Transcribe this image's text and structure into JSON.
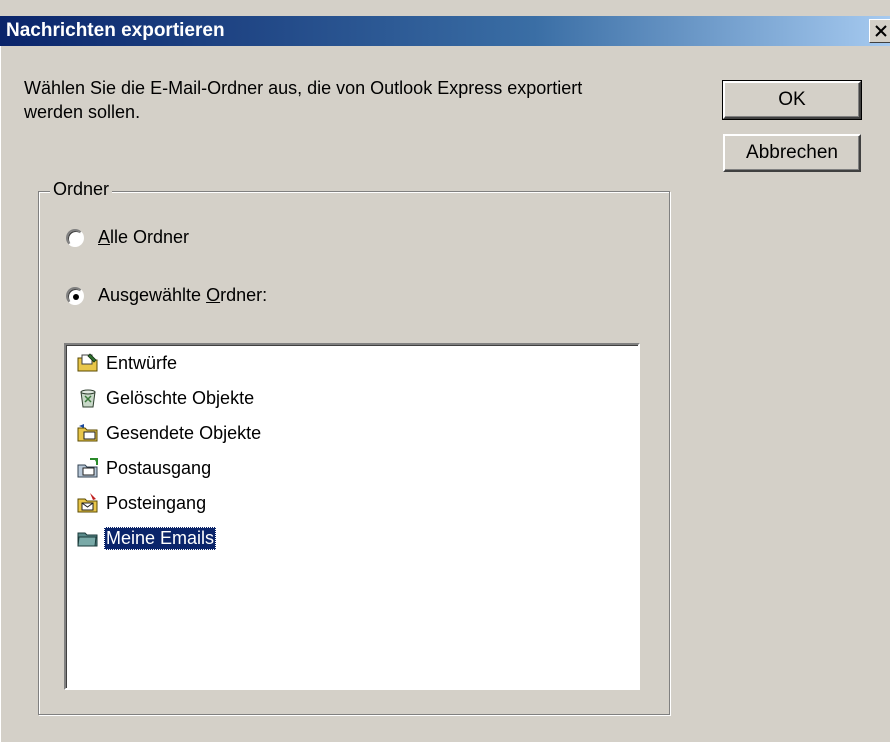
{
  "window": {
    "title": "Nachrichten exportieren"
  },
  "instruction": "Wählen Sie die E-Mail-Ordner aus, die von Outlook Express exportiert werden sollen.",
  "buttons": {
    "ok": "OK",
    "cancel": "Abbrechen"
  },
  "group": {
    "label": "Ordner",
    "radio_all": {
      "prefix": "",
      "mnemonic": "A",
      "suffix": "lle Ordner",
      "checked": false
    },
    "radio_selected": {
      "prefix": "Ausgewählte ",
      "mnemonic": "O",
      "suffix": "rdner:",
      "checked": true
    }
  },
  "folders": [
    {
      "label": "Entwürfe",
      "icon": "drafts-folder-icon",
      "selected": false
    },
    {
      "label": "Gelöschte Objekte",
      "icon": "deleted-items-folder-icon",
      "selected": false
    },
    {
      "label": "Gesendete Objekte",
      "icon": "sent-items-folder-icon",
      "selected": false
    },
    {
      "label": "Postausgang",
      "icon": "outbox-folder-icon",
      "selected": false
    },
    {
      "label": "Posteingang",
      "icon": "inbox-folder-icon",
      "selected": false
    },
    {
      "label": "Meine Emails",
      "icon": "mail-folder-icon",
      "selected": true
    }
  ],
  "colors": {
    "selection": "#0a246a",
    "dialog_bg": "#d4d0c8"
  }
}
